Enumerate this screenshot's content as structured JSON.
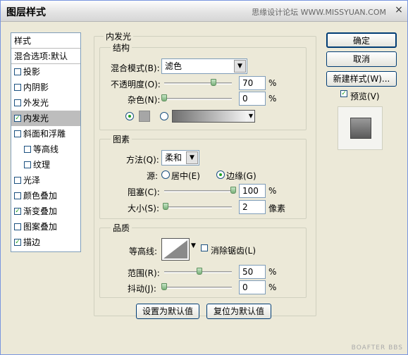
{
  "window": {
    "title": "图层样式",
    "watermark": "思缘设计论坛 WWW.MISSYUAN.COM",
    "close_glyph": "×",
    "footer_mark": "BOAFTER BBS"
  },
  "styles_panel": {
    "header": "样式",
    "blend_item": "混合选项:默认",
    "items": [
      {
        "label": "投影",
        "checked": false,
        "indent": 0
      },
      {
        "label": "内阴影",
        "checked": false,
        "indent": 0
      },
      {
        "label": "外发光",
        "checked": false,
        "indent": 0
      },
      {
        "label": "内发光",
        "checked": true,
        "indent": 0,
        "selected": true
      },
      {
        "label": "斜面和浮雕",
        "checked": false,
        "indent": 0
      },
      {
        "label": "等高线",
        "checked": false,
        "indent": 1
      },
      {
        "label": "纹理",
        "checked": false,
        "indent": 1
      },
      {
        "label": "光泽",
        "checked": false,
        "indent": 0
      },
      {
        "label": "颜色叠加",
        "checked": false,
        "indent": 0
      },
      {
        "label": "渐变叠加",
        "checked": true,
        "indent": 0
      },
      {
        "label": "图案叠加",
        "checked": false,
        "indent": 0
      },
      {
        "label": "描边",
        "checked": true,
        "indent": 0
      }
    ]
  },
  "inner_glow": {
    "title": "内发光",
    "structure": {
      "title": "结构",
      "blend_mode_label": "混合模式(B):",
      "blend_mode_value": "滤色",
      "opacity_label": "不透明度(O):",
      "opacity_value": "70",
      "noise_label": "杂色(N):",
      "noise_value": "0",
      "percent": "%"
    },
    "elements": {
      "title": "图素",
      "method_label": "方法(Q):",
      "method_value": "柔和",
      "source_label": "源:",
      "source_center": "居中(E)",
      "source_edge": "边缘(G)",
      "choke_label": "阻塞(C):",
      "choke_value": "100",
      "size_label": "大小(S):",
      "size_value": "2",
      "size_unit": "像素",
      "percent": "%"
    },
    "quality": {
      "title": "品质",
      "contour_label": "等高线:",
      "anti_alias_label": "消除锯齿(L)",
      "range_label": "范围(R):",
      "range_value": "50",
      "jitter_label": "抖动(J):",
      "jitter_value": "0",
      "percent": "%"
    },
    "default_buttons": {
      "make_default": "设置为默认值",
      "reset_default": "复位为默认值"
    }
  },
  "actions": {
    "ok": "确定",
    "cancel": "取消",
    "new_style": "新建样式(W)...",
    "preview": "预览(V)"
  }
}
